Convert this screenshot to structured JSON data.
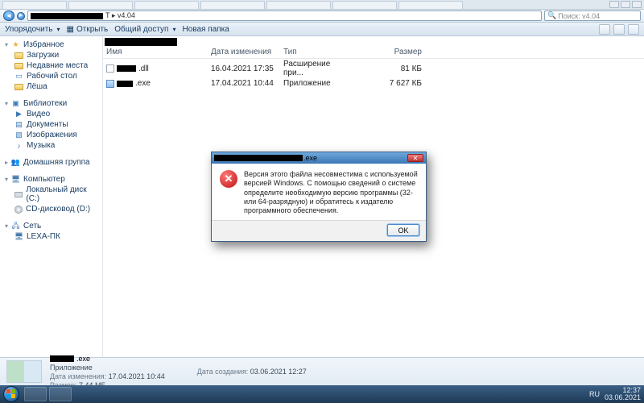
{
  "tabstrip": {
    "tab_count": 7
  },
  "navbar": {
    "crumb_tail": "T ▸ v4.04",
    "search_placeholder": "Поиск: v4.04"
  },
  "toolbar": {
    "organize": "Упорядочить",
    "open": "Открыть",
    "share": "Общий доступ",
    "newfolder": "Новая папка"
  },
  "sidebar": {
    "favorites": {
      "head": "Избранное",
      "items": [
        "Загрузки",
        "Недавние места",
        "Рабочий стол",
        "Лёша"
      ]
    },
    "libraries": {
      "head": "Библиотеки",
      "items": [
        "Видео",
        "Документы",
        "Изображения",
        "Музыка"
      ]
    },
    "homegroup": {
      "head": "Домашняя группа"
    },
    "computer": {
      "head": "Компьютер",
      "items": [
        "Локальный диск (C:)",
        "CD-дисковод (D:)"
      ]
    },
    "network": {
      "head": "Сеть",
      "items": [
        "LEXA-ПК"
      ]
    }
  },
  "columns": {
    "name": "Имя",
    "date": "Дата изменения",
    "type": "Тип",
    "size": "Размер"
  },
  "files": [
    {
      "ext": ".dll",
      "date": "16.04.2021 17:35",
      "type": "Расширение при...",
      "size": "81 КБ",
      "redact_w": 24
    },
    {
      "ext": ".exe",
      "date": "17.04.2021 10:44",
      "type": "Приложение",
      "size": "7 627 КБ",
      "redact_w": 20
    }
  ],
  "details": {
    "ext": ".exe",
    "kind": "Приложение",
    "mod_label": "Дата изменения:",
    "mod": "17.04.2021 10:44",
    "size_label": "Размер:",
    "size": "7,44 МБ",
    "created_label": "Дата создания:",
    "created": "03.06.2021 12:27"
  },
  "error": {
    "title_ext": ".exe",
    "message": "Версия этого файла несовместима с используемой версией Windows. С помощью сведений о системе определите необходимую версию программы (32- или 64-разрядную) и обратитесь к издателю программного обеспечения.",
    "ok": "OK"
  },
  "tray": {
    "lang": "RU",
    "time": "12:37",
    "date": "03.06.2021"
  }
}
